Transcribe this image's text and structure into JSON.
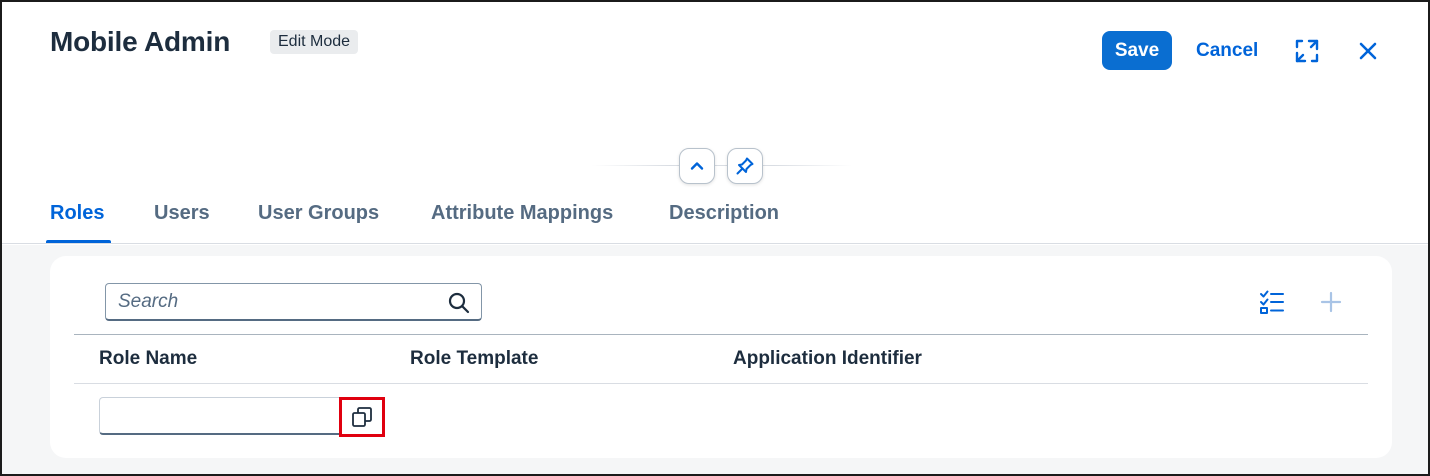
{
  "header": {
    "title": "Mobile Admin",
    "mode_badge": "Edit Mode",
    "save_label": "Save",
    "cancel_label": "Cancel",
    "icons": {
      "expand": "expand-icon",
      "close": "close-icon",
      "collapse": "chevron-up-icon",
      "pin": "pin-icon"
    }
  },
  "tabs": [
    {
      "label": "Roles",
      "active": true
    },
    {
      "label": "Users",
      "active": false
    },
    {
      "label": "User Groups",
      "active": false
    },
    {
      "label": "Attribute Mappings",
      "active": false
    },
    {
      "label": "Description",
      "active": false
    }
  ],
  "toolbar": {
    "search_placeholder": "Search",
    "search_value": "",
    "icons": {
      "search": "search-icon",
      "multi_select": "list-checks-icon",
      "add": "plus-icon"
    }
  },
  "table": {
    "columns": [
      "Role Name",
      "Role Template",
      "Application Identifier"
    ],
    "rows": [
      {
        "role_name": "",
        "role_template": "",
        "application_identifier": ""
      }
    ],
    "value_help_icon": "value-help-icon"
  },
  "colors": {
    "accent": "#0a6ed1",
    "link": "#0064d9",
    "text": "#1d2d3e",
    "muted_text": "#556b82",
    "highlight": "#e0000f",
    "page_background": "#f5f6f7"
  }
}
